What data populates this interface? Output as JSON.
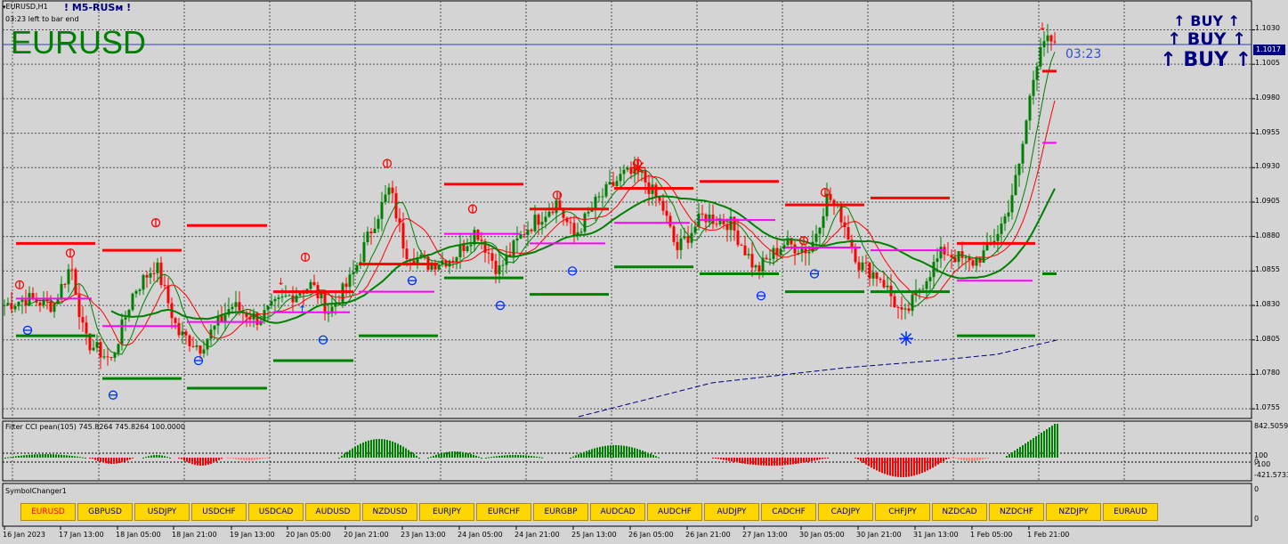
{
  "window": {
    "chart_label": "EURUSD,H1",
    "brand_label": "! M5-RUSм !",
    "bar_end_text": "03:23 left to bar end",
    "big_symbol": "EURUSD",
    "countdown": "03:23"
  },
  "buy_signals": [
    "↑ BUY ↑",
    "↑ BUY ↑",
    "↑ BUY ↑"
  ],
  "price_axis": {
    "ticks": [
      "1.1030",
      "1.1005",
      "1.0980",
      "1.0955",
      "1.0930",
      "1.0905",
      "1.0880",
      "1.0855",
      "1.0830",
      "1.0805",
      "1.0780",
      "1.0755"
    ],
    "current_price": "1.1017"
  },
  "time_axis": {
    "ticks": [
      "16 Jan 2023",
      "17 Jan 13:00",
      "18 Jan 05:00",
      "18 Jan 21:00",
      "19 Jan 13:00",
      "20 Jan 05:00",
      "20 Jan 21:00",
      "23 Jan 13:00",
      "24 Jan 05:00",
      "24 Jan 21:00",
      "25 Jan 13:00",
      "26 Jan 05:00",
      "26 Jan 21:00",
      "27 Jan 13:00",
      "30 Jan 05:00",
      "30 Jan 21:00",
      "31 Jan 13:00",
      "1 Feb 05:00",
      "1 Feb 21:00"
    ]
  },
  "indicator": {
    "label": "Filter CCI pean(105)  745.8264 745.8264 100.0000",
    "scale": [
      "842.5059",
      "100",
      "0",
      "-100",
      "-421.5733"
    ]
  },
  "symbol_changer": {
    "label": "SymbolChanger1",
    "scale": [
      "0",
      "0"
    ],
    "active": "EURUSD",
    "buttons": [
      "EURUSD",
      "GBPUSD",
      "USDJPY",
      "USDCHF",
      "USDCAD",
      "AUDUSD",
      "NZDUSD",
      "EURJPY",
      "EURCHF",
      "EURGBP",
      "AUDCAD",
      "AUDCHF",
      "AUDJPY",
      "CADCHF",
      "CADJPY",
      "CHFJPY",
      "NZDCAD",
      "NZDCHF",
      "NZDJPY",
      "EURAUD"
    ]
  },
  "colors": {
    "background": "#d4d4d4",
    "bull_candle": "#008000",
    "bear_candle": "#ff0000",
    "brand_green": "#008000",
    "accent_blue": "#000080",
    "button_yellow": "#ffd700"
  },
  "chart_data": {
    "type": "candlestick",
    "symbol": "EURUSD",
    "timeframe": "H1",
    "ylim": [
      1.0748,
      1.104
    ],
    "x_range": [
      "16 Jan 2023",
      "1 Feb 21:00"
    ],
    "current_price": 1.1017,
    "grid": true
  }
}
